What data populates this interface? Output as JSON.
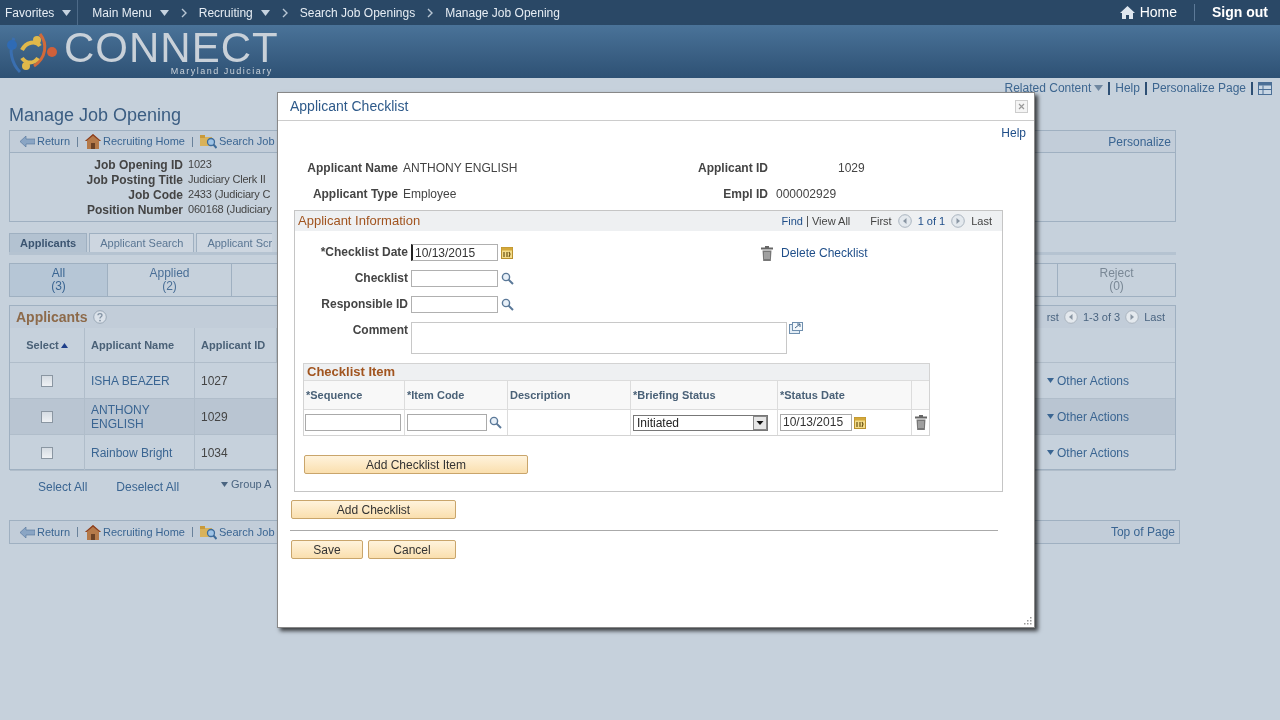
{
  "top_nav": {
    "items": [
      {
        "label": "Favorites",
        "dropdown": true
      },
      {
        "label": "Main Menu",
        "dropdown": true
      },
      {
        "label": "Recruiting",
        "dropdown": true
      },
      {
        "label": "Search Job Openings",
        "dropdown": false
      },
      {
        "label": "Manage Job Opening",
        "dropdown": false
      }
    ],
    "home": "Home",
    "sign_out": "Sign out"
  },
  "logo": {
    "name": "CONNECT",
    "subtitle": "Maryland Judiciary"
  },
  "header_links": [
    {
      "label": "Related Content",
      "dropdown": true
    },
    {
      "label": "Help",
      "dropdown": false
    },
    {
      "label": "Personalize Page",
      "dropdown": false
    }
  ],
  "page_title": "Manage Job Opening",
  "toolbar": {
    "items": [
      {
        "label": "Return",
        "kind": "back"
      },
      {
        "label": "Recruiting Home",
        "kind": "home"
      },
      {
        "label": "Search Job",
        "kind": "search"
      }
    ],
    "right": "Personalize"
  },
  "job_info": [
    {
      "label": "Job Opening ID",
      "value": "1023"
    },
    {
      "label": "Job Posting Title",
      "value": "Judiciary Clerk II"
    },
    {
      "label": "Job Code",
      "value": "2433 (Judiciary C"
    },
    {
      "label": "Position Number",
      "value": "060168 (Judiciary"
    }
  ],
  "tabs": [
    {
      "label": "Applicants",
      "selected": true
    },
    {
      "label": "Applicant Search",
      "selected": false
    },
    {
      "label": "Applicant Scr",
      "selected": false
    }
  ],
  "status_tabs": [
    {
      "label": "All",
      "count": "(3)",
      "selected": true
    },
    {
      "label": "Applied",
      "count": "(2)",
      "selected": false
    },
    {
      "label": "Reject",
      "count": "(0)",
      "selected": false
    }
  ],
  "applicants": {
    "title": "Applicants",
    "nav": {
      "first": "rst",
      "range": "1-3 of 3",
      "last": "Last"
    },
    "columns": [
      "Select",
      "Applicant Name",
      "Applicant ID"
    ],
    "rows": [
      {
        "name": "ISHA BEAZER",
        "id": "1027",
        "checked": false,
        "selected": false,
        "action": "Other Actions"
      },
      {
        "name": "ANTHONY ENGLISH",
        "id": "1029",
        "checked": false,
        "selected": true,
        "action": "Other Actions"
      },
      {
        "name": "Rainbow Bright",
        "id": "1034",
        "checked": false,
        "selected": false,
        "action": "Other Actions"
      }
    ]
  },
  "grid_actions": [
    {
      "label": "Select All",
      "dropdown": false
    },
    {
      "label": "Deselect All",
      "dropdown": false
    },
    {
      "label": "Group A",
      "dropdown": true
    }
  ],
  "bottom_toolbar": {
    "items": [
      {
        "label": "Return",
        "kind": "back"
      },
      {
        "label": "Recruiting Home",
        "kind": "home"
      },
      {
        "label": "Search Job",
        "kind": "search"
      }
    ],
    "right": "Top of Page"
  },
  "dialog": {
    "title": "Applicant Checklist",
    "help": "Help",
    "summary": [
      {
        "label": "Applicant Name",
        "value": "ANTHONY ENGLISH"
      },
      {
        "label": "Applicant ID",
        "value": "1029"
      },
      {
        "label": "Applicant Type",
        "value": "Employee"
      },
      {
        "label": "Empl ID",
        "value": "000002929"
      }
    ],
    "section": {
      "title": "Applicant Information",
      "find": "Find",
      "view_all": "View All",
      "first": "First",
      "range": "1 of 1",
      "last": "Last",
      "fields": [
        {
          "label": "*Checklist Date",
          "kind": "date",
          "value": "10/13/2015"
        },
        {
          "label": "Checklist",
          "kind": "lookup"
        },
        {
          "label": "Responsible ID",
          "kind": "lookup"
        },
        {
          "label": "Comment",
          "kind": "textarea"
        }
      ],
      "delete": "Delete Checklist",
      "items_grid": {
        "title": "Checklist Item",
        "columns": [
          "*Sequence",
          "*Item Code",
          "Description",
          "*Briefing Status",
          "*Status Date"
        ],
        "rows": [
          {
            "briefing_status": "Initiated",
            "status_date": "10/13/2015"
          }
        ]
      },
      "add_item": "Add Checklist Item"
    },
    "add_checklist": "Add Checklist",
    "save": "Save",
    "cancel": "Cancel"
  }
}
